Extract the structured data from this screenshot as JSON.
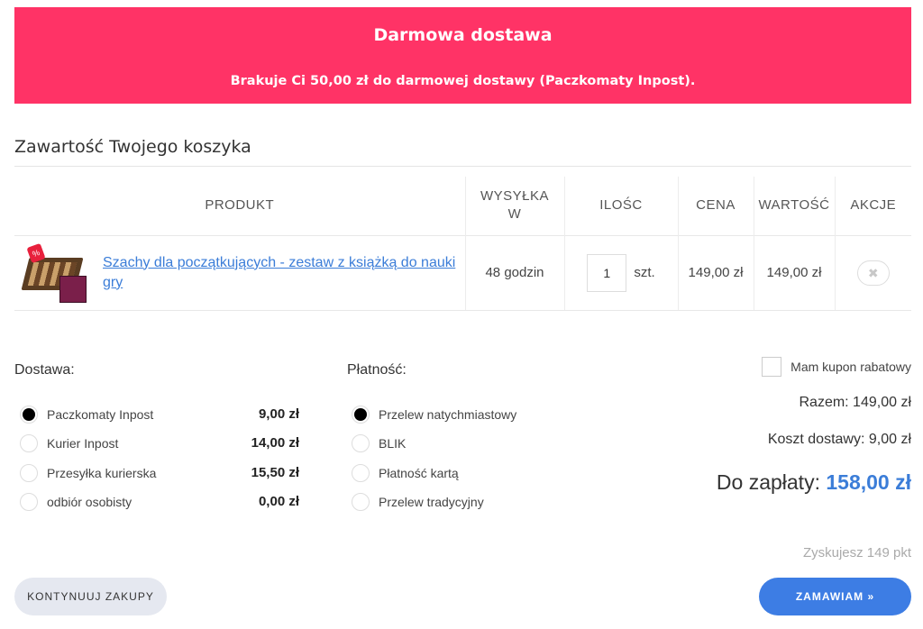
{
  "banner": {
    "title": "Darmowa dostawa",
    "message": "Brakuje Ci 50,00 zł do darmowej dostawy (Paczkomaty Inpost)."
  },
  "cart": {
    "heading": "Zawartość Twojego koszyka",
    "columns": {
      "product": "PRODUKT",
      "shipping": "WYSYŁKA W",
      "quantity": "ILOŚC",
      "price": "CENA",
      "value": "WARTOŚĆ",
      "actions": "AKCJE"
    },
    "items": [
      {
        "name": "Szachy dla początkujących - zestaw z książką do nauki gry",
        "shipping_time": "48 godzin",
        "quantity": "1",
        "unit": "szt.",
        "price": "149,00 zł",
        "value": "149,00 zł",
        "badge": "%",
        "remove_icon": "close-icon",
        "remove_glyph": "✖"
      }
    ]
  },
  "delivery": {
    "label": "Dostawa:",
    "options": [
      {
        "name": "Paczkomaty Inpost",
        "price": "9,00 zł",
        "selected": true
      },
      {
        "name": "Kurier Inpost",
        "price": "14,00 zł",
        "selected": false
      },
      {
        "name": "Przesyłka kurierska",
        "price": "15,50 zł",
        "selected": false
      },
      {
        "name": "odbiór osobisty",
        "price": "0,00 zł",
        "selected": false
      }
    ]
  },
  "payment": {
    "label": "Płatność:",
    "options": [
      {
        "name": "Przelew natychmiastowy",
        "selected": true
      },
      {
        "name": "BLIK",
        "selected": false
      },
      {
        "name": "Płatność kartą",
        "selected": false
      },
      {
        "name": "Przelew tradycyjny",
        "selected": false
      }
    ]
  },
  "summary": {
    "coupon_label": "Mam kupon rabatowy",
    "subtotal": "Razem: 149,00 zł",
    "delivery_cost": "Koszt dostawy: 9,00 zł",
    "total_label": "Do zapłaty:",
    "total_amount": "158,00 zł",
    "points": "Zyskujesz 149 pkt"
  },
  "actions": {
    "continue_label": "KONTYNUUJ ZAKUPY",
    "order_label": "ZAMAWIAM »"
  },
  "colors": {
    "banner": "#ff3366",
    "accent": "#3d7de4",
    "link": "#3b7dd8"
  }
}
